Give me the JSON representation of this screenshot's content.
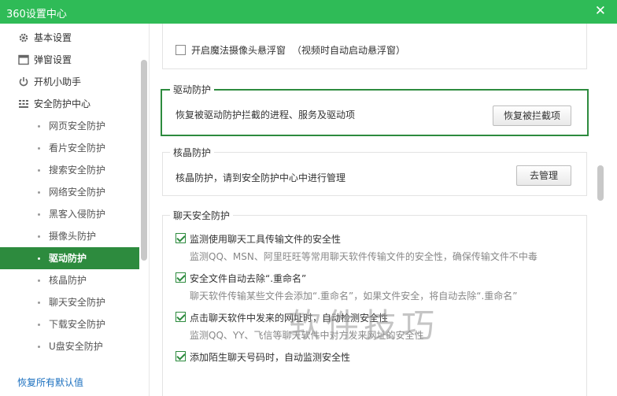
{
  "window": {
    "title": "360设置中心",
    "close_symbol": "✕"
  },
  "sidebar": {
    "top_items": [
      {
        "label": "基本设置",
        "icon": "gear-icon"
      },
      {
        "label": "弹窗设置",
        "icon": "window-icon"
      },
      {
        "label": "开机小助手",
        "icon": "power-icon"
      },
      {
        "label": "安全防护中心",
        "icon": "shield-grid-icon"
      }
    ],
    "sub_items": [
      "网页安全防护",
      "看片安全防护",
      "搜索安全防护",
      "网络安全防护",
      "黑客入侵防护",
      "摄像头防护",
      "驱动防护",
      "核晶防护",
      "聊天安全防护",
      "下载安全防护",
      "U盘安全防护"
    ],
    "active_sub_item": "驱动防护",
    "restore_defaults": "恢复所有默认值"
  },
  "content": {
    "camera": {
      "checkbox_label": "开启魔法摄像头悬浮窗",
      "checkbox_note": "（视频时自动启动悬浮窗）",
      "checked": false
    },
    "driver": {
      "title": "驱动防护",
      "description": "恢复被驱动防护拦截的进程、服务及驱动项",
      "button": "恢复被拦截项"
    },
    "nucleus": {
      "title": "核晶防护",
      "description": "核晶防护，请到安全防护中心中进行管理",
      "button": "去管理"
    },
    "chat": {
      "title": "聊天安全防护",
      "options": [
        {
          "label": "监测使用聊天工具传输文件的安全性",
          "desc": "监测QQ、MSN、阿里旺旺等常用聊天软件传输文件的安全性，确保传输文件不中毒",
          "checked": true
        },
        {
          "label": "安全文件自动去除“.重命名”",
          "desc": "聊天软件传输某些文件会添加“.重命名”，如果文件安全，将自动去除“.重命名”",
          "checked": true
        },
        {
          "label": "点击聊天软件中发来的网址时，自动检测安全性",
          "desc": "监测QQ、YY、飞信等聊天软件中对方发来网址的安全性",
          "checked": true
        },
        {
          "label": "添加陌生聊天号码时，自动监测安全性",
          "desc": "",
          "checked": true
        }
      ]
    }
  },
  "watermark": "软件技巧",
  "colors": {
    "titlebar": "#2fbb57",
    "active_item": "#2d8b3e",
    "highlight_border": "#2d8b3e",
    "link": "#1a6fbf"
  }
}
